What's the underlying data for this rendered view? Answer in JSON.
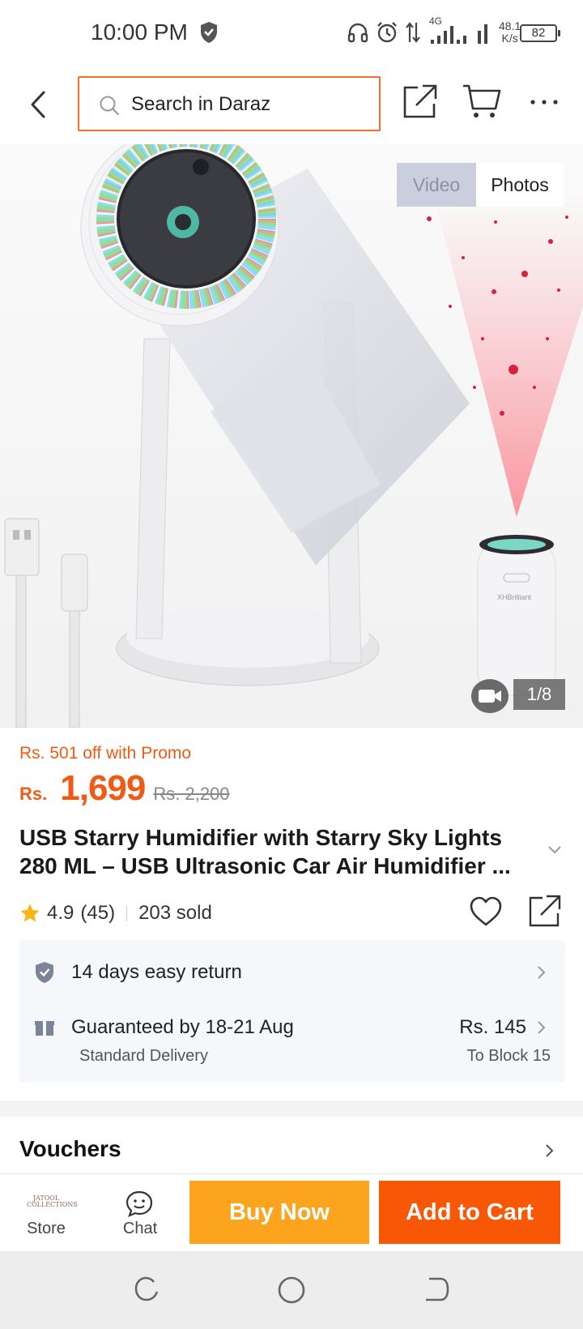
{
  "status_bar": {
    "time": "10:00 PM",
    "network_type": "4G",
    "net_speed_value": "48.1",
    "net_speed_unit": "K/s",
    "battery": "82",
    "icons": [
      "shield-icon",
      "headphones-icon",
      "alarm-icon",
      "data-transfer-icon",
      "signal-icon",
      "signal-icon"
    ]
  },
  "header": {
    "search_placeholder": "Search in Daraz",
    "icons": [
      "back-icon",
      "search-icon",
      "share-icon",
      "cart-icon",
      "more-icon"
    ]
  },
  "gallery": {
    "tabs": [
      "Video",
      "Photos"
    ],
    "active_tab": "Photos",
    "page_indicator": "1/8",
    "product_brand_mark": "XHBrilliant"
  },
  "product": {
    "promo": "Rs. 501 off with Promo",
    "currency": "Rs.",
    "price": "1,699",
    "original_price": "Rs. 2,200",
    "title_line1": "USB Starry Humidifier with Starry Sky Lights",
    "title_line2": "280 ML – USB Ultrasonic Car Air Humidifier ...",
    "rating": "4.9",
    "rating_count": "(45)",
    "sold": "203 sold"
  },
  "delivery": {
    "return_policy": "14 days easy return",
    "guarantee": "Guaranteed by 18-21 Aug",
    "method": "Standard Delivery",
    "fee": "Rs. 145",
    "destination": "To Block 15"
  },
  "vouchers": {
    "title": "Vouchers"
  },
  "action_bar": {
    "store_logo_text": "JATOOL COLLECTIONS",
    "store_label": "Store",
    "chat_label": "Chat",
    "buy_now": "Buy Now",
    "add_to_cart": "Add to Cart"
  },
  "colors": {
    "accent_orange": "#f85706",
    "buy_now_yellow": "#fca41e",
    "price_orange": "#f05a14"
  }
}
